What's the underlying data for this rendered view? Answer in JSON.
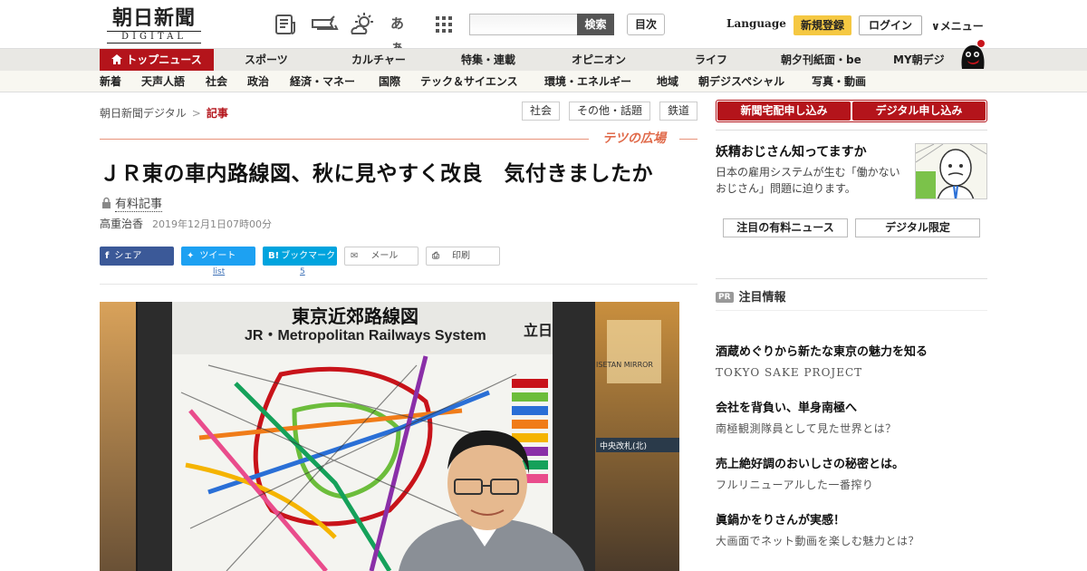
{
  "header": {
    "logo_jp": "朝日新聞",
    "logo_en": "DIGITAL",
    "search_button": "検索",
    "index_button": "目次",
    "language": "Language",
    "register": "新規登録",
    "login": "ログイン",
    "menu": "メニュー",
    "font_size_icon_label": "あぁ"
  },
  "nav_primary": [
    "トップニュース",
    "スポーツ",
    "カルチャー",
    "特集・連載",
    "オピニオン",
    "ライフ",
    "朝夕刊紙面・be",
    "MY朝デジ"
  ],
  "nav_secondary": [
    "新着",
    "天声人語",
    "社会",
    "政治",
    "経済・マネー",
    "国際",
    "テック＆サイエンス",
    "環境・エネルギー",
    "地域",
    "朝デジスペシャル",
    "写真・動画"
  ],
  "breadcrumb": {
    "home": "朝日新聞デジタル",
    "separator": ">",
    "current": "記事"
  },
  "tags": [
    "社会",
    "その他・話題",
    "鉄道"
  ],
  "article": {
    "section_label": "テツの広場",
    "headline": "ＪＲ東の車内路線図、秋に見やすく改良　気付きましたか",
    "paid_label": "有料記事",
    "author": "高重治香",
    "date": "2019年12月1日07時00分",
    "share": {
      "facebook": "シェア",
      "twitter": "ツイート",
      "twitter_sub": "list",
      "hatena": "ブックマーク",
      "hatena_count": "5",
      "mail": "メール",
      "print": "印刷"
    },
    "photo": {
      "sign_title_jp": "東京近郊路線図",
      "sign_title_en": "JR・Metropolitan Railways System",
      "sign_side": "立日",
      "station_sign": "中央改札(北)",
      "shop_sign": "ISETAN MIRROR"
    }
  },
  "sidebar": {
    "buttons": [
      "新聞宅配申し込み",
      "デジタル申し込み"
    ],
    "feature": {
      "title": "妖精おじさん知ってますか",
      "desc": "日本の雇用システムが生む「働かないおじさん」問題に迫ります。"
    },
    "tabs": [
      "注目の有料ニュース",
      "デジタル限定"
    ],
    "pr_label": "PR",
    "pr_heading": "注目情報",
    "pr_items": [
      {
        "title": "酒蔵めぐりから新たな東京の魅力を知る",
        "sub": "TOKYO SAKE PROJECT"
      },
      {
        "title": "会社を背負い、単身南極へ",
        "sub": "南極観測隊員として見た世界とは？"
      },
      {
        "title": "売上絶好調のおいしさの秘密とは。",
        "sub": "フルリニューアルした一番搾り"
      },
      {
        "title": "眞鍋かをりさんが実感！",
        "sub": "大画面でネット動画を楽しむ魅力とは？"
      }
    ]
  },
  "colors": {
    "brand_red": "#b4141b",
    "register_yellow": "#f5c842",
    "facebook": "#3b5998",
    "twitter": "#1da1f2",
    "hatena": "#00a4de",
    "section_orange": "#e06a4a"
  }
}
